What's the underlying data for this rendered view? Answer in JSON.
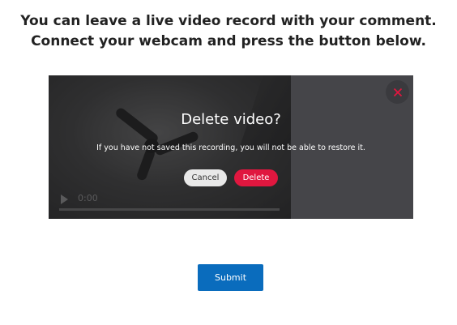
{
  "instructions": {
    "line1": "You can leave a live video record with your comment.",
    "line2": "Connect your webcam and press the button below."
  },
  "video": {
    "time": "0:00"
  },
  "dialog": {
    "title": "Delete video?",
    "message": "If you have not saved this recording, you will not be able to restore it.",
    "cancel_label": "Cancel",
    "delete_label": "Delete"
  },
  "submit_label": "Submit",
  "colors": {
    "delete": "#e0173f",
    "submit": "#0a6cbd",
    "close": "#e0173f"
  },
  "icons": {
    "close": "close-icon",
    "play": "play-icon"
  }
}
